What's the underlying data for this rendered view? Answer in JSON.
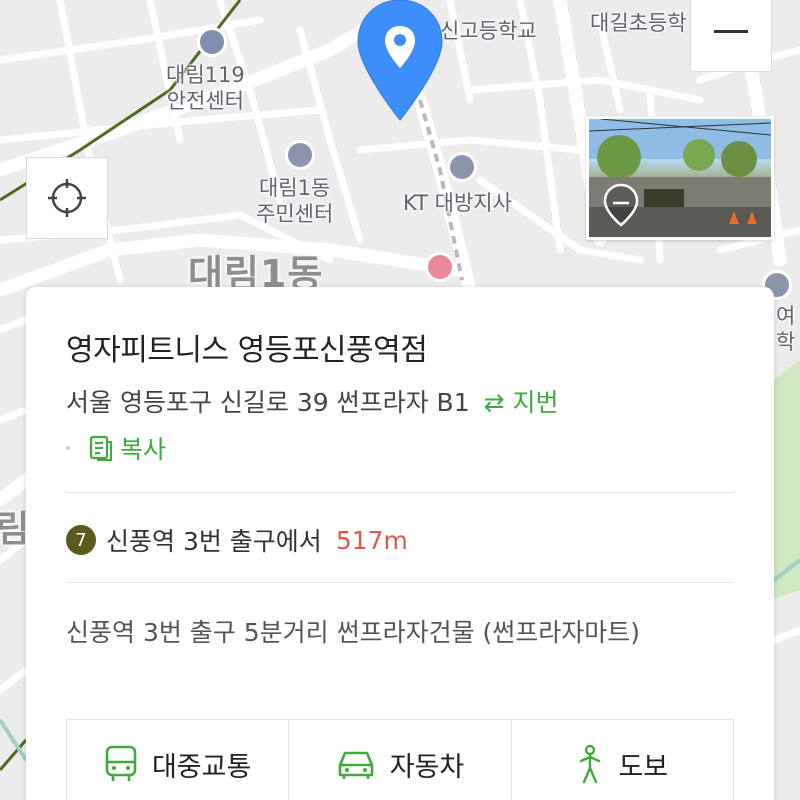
{
  "map": {
    "labels": {
      "fire_station": "대림119\n안전센터",
      "community_center": "대림1동\n주민센터",
      "kt": "KT 대방지사",
      "high_school": "신고등학교",
      "elementary": "대길초등학",
      "district": "대림1동",
      "edge_right": "여\n학",
      "edge_left": "림"
    },
    "zoom_out_icon": "minus-icon",
    "locate_icon": "crosshair-icon",
    "pin_icon": "location-pin-icon",
    "colors": {
      "pin": "#3d8ef8",
      "road": "#ffffff",
      "park": "#cfe8c1",
      "rail": "#4f6b1f"
    }
  },
  "place": {
    "name": "영자피트니스 영등포신풍역점",
    "address": "서울 영등포구 신길로 39 썬프라자 B1",
    "address_toggle": "⇄ 지번",
    "copy_label": "복사",
    "station_line": "7",
    "station_text": "신풍역 3번 출구에서",
    "distance": "517m",
    "description": "신풍역 3번 출구 5분거리 썬프라자건물 (썬프라자마트)",
    "accent": "#3eaa3f",
    "distance_color": "#e2574c"
  },
  "routes": [
    {
      "label": "대중교통",
      "icon": "bus-icon"
    },
    {
      "label": "자동차",
      "icon": "car-icon"
    },
    {
      "label": "도보",
      "icon": "walking-person-icon"
    }
  ]
}
